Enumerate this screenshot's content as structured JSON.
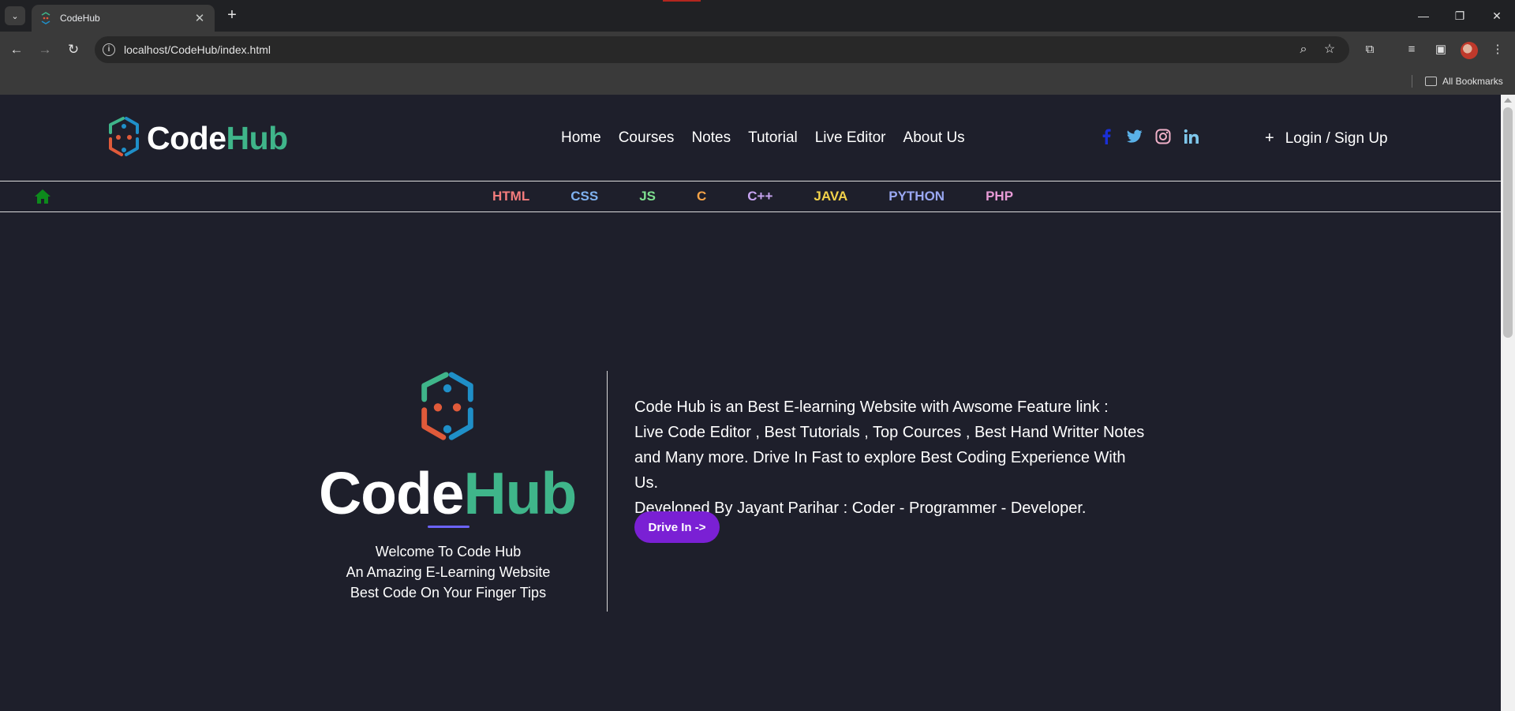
{
  "browser": {
    "tab_title": "CodeHub",
    "url": "localhost/CodeHub/index.html",
    "bookmarks_label": "All Bookmarks"
  },
  "site": {
    "brand_part1": "Code",
    "brand_part2": "Hub",
    "nav": [
      "Home",
      "Courses",
      "Notes",
      "Tutorial",
      "Live Editor",
      "About Us"
    ],
    "social_icons": [
      "facebook-icon",
      "twitter-icon",
      "instagram-icon",
      "linkedin-icon"
    ],
    "login_label": "Login / Sign Up",
    "login_plus": "+"
  },
  "languages": [
    {
      "label": "HTML",
      "color": "#f47c7c"
    },
    {
      "label": "CSS",
      "color": "#7fb2f0"
    },
    {
      "label": "JS",
      "color": "#7ee08f"
    },
    {
      "label": "C",
      "color": "#f5a347"
    },
    {
      "label": "C++",
      "color": "#c7a4f2"
    },
    {
      "label": "JAVA",
      "color": "#f2d24b"
    },
    {
      "label": "PYTHON",
      "color": "#9aa8f2"
    },
    {
      "label": "PHP",
      "color": "#e79ad6"
    }
  ],
  "hero": {
    "tagline": [
      "Welcome To Code Hub",
      "An Amazing E-Learning Website",
      "Best Code On Your Finger Tips"
    ],
    "about_lines": [
      "Code Hub is an Best E-learning Website with Awsome Feature link :",
      "Live Code Editor , Best Tutorials , Top Cources , Best Hand Writter Notes",
      "and Many more. Drive In Fast to explore Best Coding Experience With",
      "Us.",
      "Developed By Jayant Parihar : Coder - Programmer - Developer."
    ],
    "cta_label": "Drive In ->"
  },
  "colors": {
    "accent_green": "#3fb58a",
    "cta_purple": "#7a20d4",
    "page_bg": "#1e1f2b"
  }
}
